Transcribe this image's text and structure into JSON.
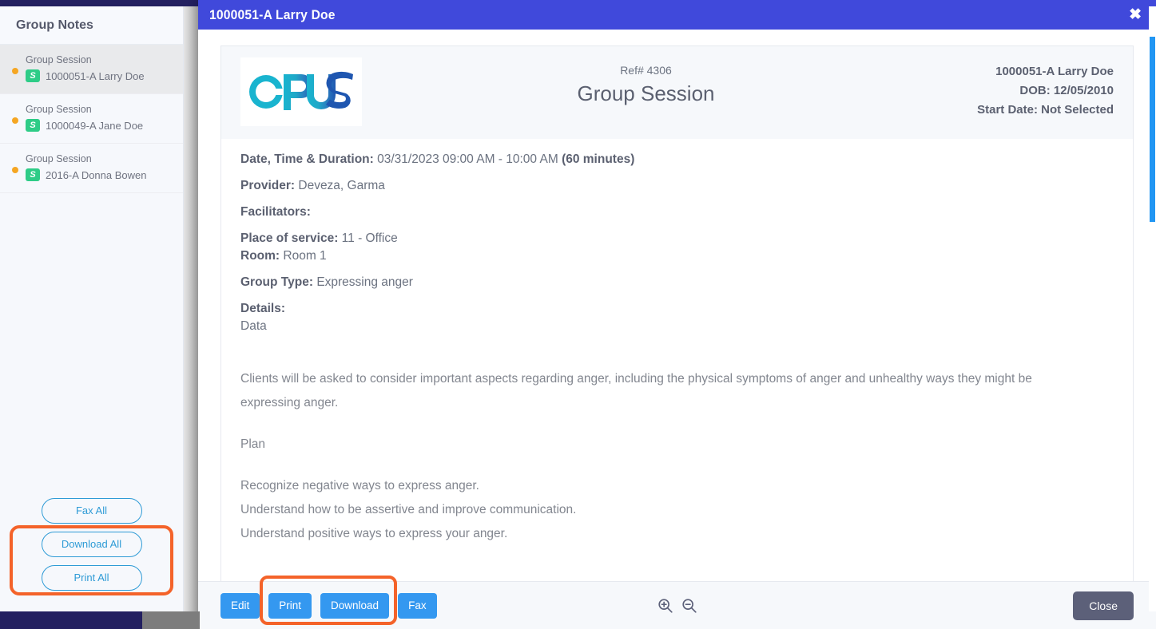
{
  "sidebar": {
    "title": "Group Notes",
    "notes": [
      {
        "type": "Group Session",
        "badge": "S",
        "name": "1000051-A Larry Doe",
        "active": true
      },
      {
        "type": "Group Session",
        "badge": "S",
        "name": "1000049-A Jane Doe",
        "active": false
      },
      {
        "type": "Group Session",
        "badge": "S",
        "name": "2016-A Donna Bowen",
        "active": false
      }
    ],
    "actions": {
      "fax_all": "Fax All",
      "download_all": "Download All",
      "print_all": "Print All"
    }
  },
  "modal": {
    "title": "1000051-A Larry Doe",
    "close_icon": "close-icon",
    "document": {
      "logo_text": "OPUS",
      "ref_label": "Ref# 4306",
      "doc_type": "Group Session",
      "patient": "1000051-A Larry Doe",
      "dob": "DOB: 12/05/2010",
      "start_date": "Start Date: Not Selected",
      "fields": {
        "datetime_label": "Date, Time & Duration:",
        "datetime_value": "03/31/2023 09:00 AM - 10:00 AM",
        "duration": "(60 minutes)",
        "provider_label": "Provider:",
        "provider_value": "Deveza, Garma",
        "facilitators_label": "Facilitators:",
        "facilitators_value": "",
        "place_label": "Place of service:",
        "place_value": "11 - Office",
        "room_label": "Room:",
        "room_value": "Room 1",
        "group_type_label": "Group Type:",
        "group_type_value": "Expressing anger",
        "details_label": "Details:",
        "details_value": "Data"
      },
      "body": {
        "paragraph1": "Clients will be asked to consider important aspects regarding anger, including the physical symptoms of anger and unhealthy ways they might be expressing anger.",
        "plan_heading": "Plan",
        "plan_line1": "Recognize negative ways to express anger.",
        "plan_line2": "Understand how to be assertive and improve communication.",
        "plan_line3": "Understand positive ways to express your anger."
      }
    },
    "footer": {
      "edit": "Edit",
      "print": "Print",
      "download": "Download",
      "fax": "Fax",
      "zoom_in_icon": "zoom-in-icon",
      "zoom_out_icon": "zoom-out-icon",
      "close": "Close"
    }
  },
  "colors": {
    "modal_header": "#4049db",
    "accent_blue": "#3498f0",
    "highlight_orange": "#f4632a",
    "badge_green": "#2ecc87",
    "dot_orange": "#f5a623",
    "close_gray": "#5c6079",
    "navy_bar": "#232060",
    "scrollbar_blue": "#2196f3"
  }
}
